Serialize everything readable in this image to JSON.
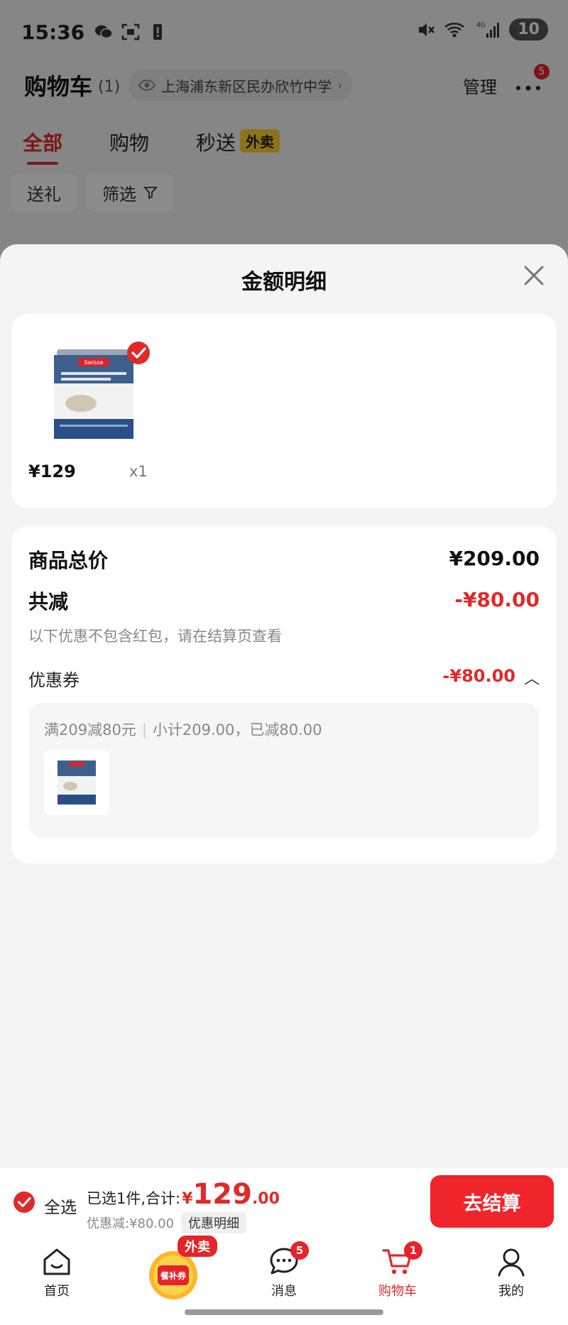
{
  "status_bar": {
    "time": "15:36",
    "network": "4G",
    "battery": "10"
  },
  "header": {
    "title": "购物车",
    "count": "(1)",
    "address": "上海浦东新区民办欣竹中学",
    "manage_label": "管理",
    "more_badge": "5"
  },
  "tabs": [
    {
      "label": "全部",
      "active": true
    },
    {
      "label": "购物",
      "active": false
    },
    {
      "label": "秒送",
      "active": false,
      "badge": "外卖"
    }
  ],
  "filters": {
    "gift_label": "送礼",
    "filter_label": "筛选"
  },
  "sheet": {
    "title": "金额明细",
    "item": {
      "price": "¥129",
      "qty": "x1",
      "image_text": "Swisse"
    },
    "total_label": "商品总价",
    "total_value": "¥209.00",
    "reduce_label": "共减",
    "reduce_value": "-¥80.00",
    "note": "以下优惠不包含红包，请在结算页查看",
    "coupon_label": "优惠券",
    "coupon_value": "-¥80.00",
    "coupon_rule": "满209减80元",
    "coupon_subtotal": "小计209.00，已减80.00"
  },
  "bottom_bar": {
    "select_all_label": "全选",
    "selected_text": "已选1件,合计:",
    "currency": "¥",
    "amount_int": "129",
    "amount_dec": ".00",
    "discount_text": "优惠减:¥80.00",
    "detail_label": "优惠明细",
    "checkout_label": "去结算"
  },
  "tabbar": {
    "items": [
      {
        "label": "首页",
        "icon": "home-icon"
      },
      {
        "label": "",
        "icon": "coupon-promo-icon",
        "tag": "外卖",
        "promo_text": "餐补券"
      },
      {
        "label": "消息",
        "icon": "message-icon",
        "badge": "5"
      },
      {
        "label": "购物车",
        "icon": "cart-icon",
        "badge": "1",
        "active": true
      },
      {
        "label": "我的",
        "icon": "profile-icon"
      }
    ]
  },
  "colors": {
    "accent": "#e02a2a",
    "checkout": "#f0252b",
    "badge": "#e5232a"
  }
}
